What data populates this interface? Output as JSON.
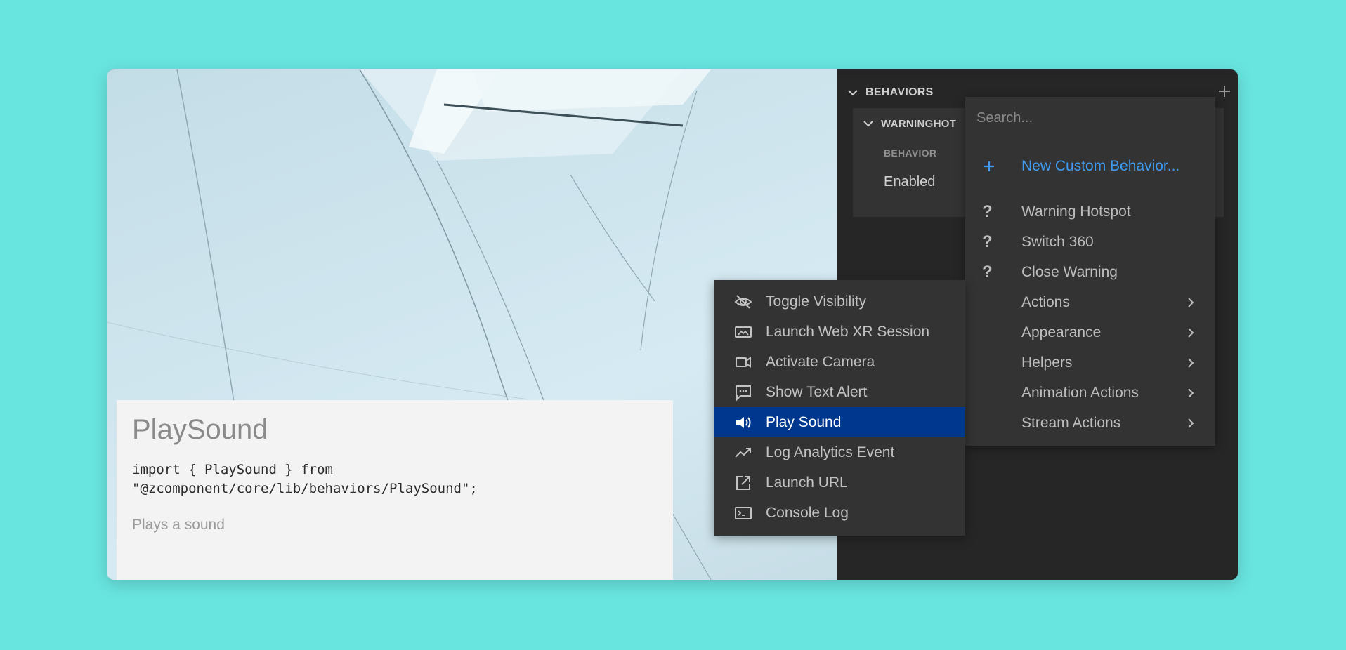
{
  "doc": {
    "title": "PlaySound",
    "code_line1": "import { PlaySound } from",
    "code_line2": "\"@zcomponent/core/lib/behaviors/PlaySound\";",
    "description": "Plays a sound"
  },
  "panel": {
    "section_title": "BEHAVIORS",
    "behavior_name": "WARNINGHOT",
    "field_label": "BEHAVIOR",
    "field_value": "Enabled"
  },
  "dropdown": {
    "search_placeholder": "Search...",
    "new_custom_label": "New Custom Behavior...",
    "items": [
      {
        "label": "Warning Hotspot",
        "icon": "question-icon"
      },
      {
        "label": "Switch 360",
        "icon": "question-icon"
      },
      {
        "label": "Close Warning",
        "icon": "question-icon"
      }
    ],
    "categories": [
      {
        "label": "Actions"
      },
      {
        "label": "Appearance"
      },
      {
        "label": "Helpers"
      },
      {
        "label": "Animation Actions"
      },
      {
        "label": "Stream Actions"
      }
    ]
  },
  "submenu": {
    "items": [
      {
        "label": "Toggle Visibility",
        "icon": "eye-off-icon"
      },
      {
        "label": "Launch Web XR Session",
        "icon": "xr-headset-icon"
      },
      {
        "label": "Activate Camera",
        "icon": "video-camera-icon"
      },
      {
        "label": "Show Text Alert",
        "icon": "message-icon"
      },
      {
        "label": "Play Sound",
        "icon": "speaker-icon",
        "active": true
      },
      {
        "label": "Log Analytics Event",
        "icon": "trending-up-icon"
      },
      {
        "label": "Launch URL",
        "icon": "external-link-icon"
      },
      {
        "label": "Console Log",
        "icon": "terminal-icon"
      }
    ]
  },
  "colors": {
    "background": "#69e5e0",
    "panel": "#262626",
    "menu": "#333333",
    "highlight": "#00378e",
    "link": "#3e9bf0"
  }
}
